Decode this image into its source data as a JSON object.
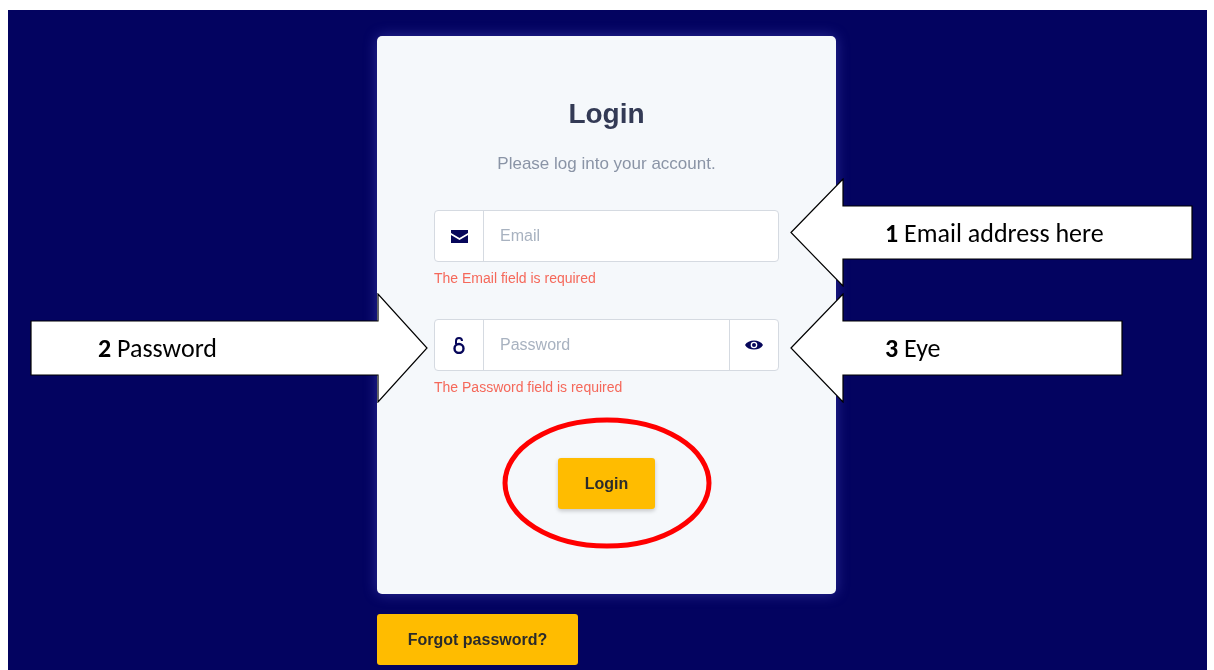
{
  "card": {
    "title": "Login",
    "subtitle": "Please log into your account.",
    "fields": [
      {
        "kind": "email",
        "placeholder": "Email",
        "error": "The Email field is required"
      },
      {
        "kind": "password",
        "placeholder": "Password",
        "error": "The Password field is required"
      }
    ],
    "button": "Login"
  },
  "forgot_button": "Forgot password?",
  "annotations": [
    {
      "text": "**1** Email address here",
      "kind": "left"
    },
    {
      "text": "**2** Password",
      "kind": "right"
    },
    {
      "text": "**3** Eye",
      "kind": "left"
    }
  ]
}
